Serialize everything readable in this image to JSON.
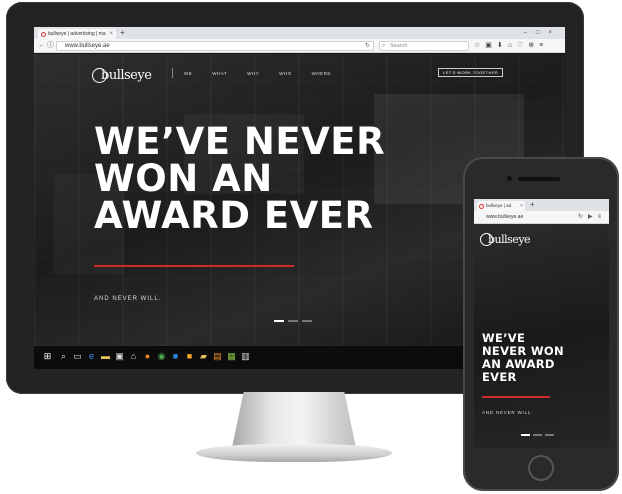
{
  "desktop": {
    "browser": {
      "tab_title": "bullseye | advertising | ma",
      "tab_close": "×",
      "new_tab": "+",
      "window_controls": "–□×",
      "url": "www.bullseye.ae",
      "search_placeholder": "Search",
      "back_icon": "←",
      "info_icon": "ⓘ",
      "reload_icon": "↻",
      "search_icon": "⌕",
      "toolbar_icons": "☆▣⬇⌂♡⊕≡"
    },
    "site": {
      "logo_text": "bullseye",
      "nav": [
        "WE",
        "WHAT",
        "WHY",
        "WHO",
        "WHERE"
      ],
      "cta": "LET'S WORK TOGETHER",
      "hero_lines": [
        "WE’VE NEVER",
        "WON AN",
        "AWARD EVER"
      ],
      "subline": "AND NEVER WILL.",
      "accent_color": "#d12a2a"
    },
    "taskbar_icons": [
      "windows-icon",
      "search-icon",
      "task-view-icon",
      "edge-icon",
      "file-explorer-icon",
      "store-icon",
      "home-icon",
      "firefox-icon",
      "chrome-icon",
      "photoshop-icon",
      "illustrator-icon",
      "folder-icon",
      "sublime-icon",
      "app-icon",
      "calculator-icon"
    ]
  },
  "mobile": {
    "tab_title": "bullseye | ad",
    "tab_close": "×",
    "new_tab": "+",
    "url": "www.bullseye.ae",
    "nav_icons": "↻▶≡",
    "logo_text": "bullseye",
    "hero_lines": [
      "WE’VE",
      "NEVER WON",
      "AN AWARD",
      "EVER"
    ],
    "subline": "AND NEVER WILL."
  }
}
